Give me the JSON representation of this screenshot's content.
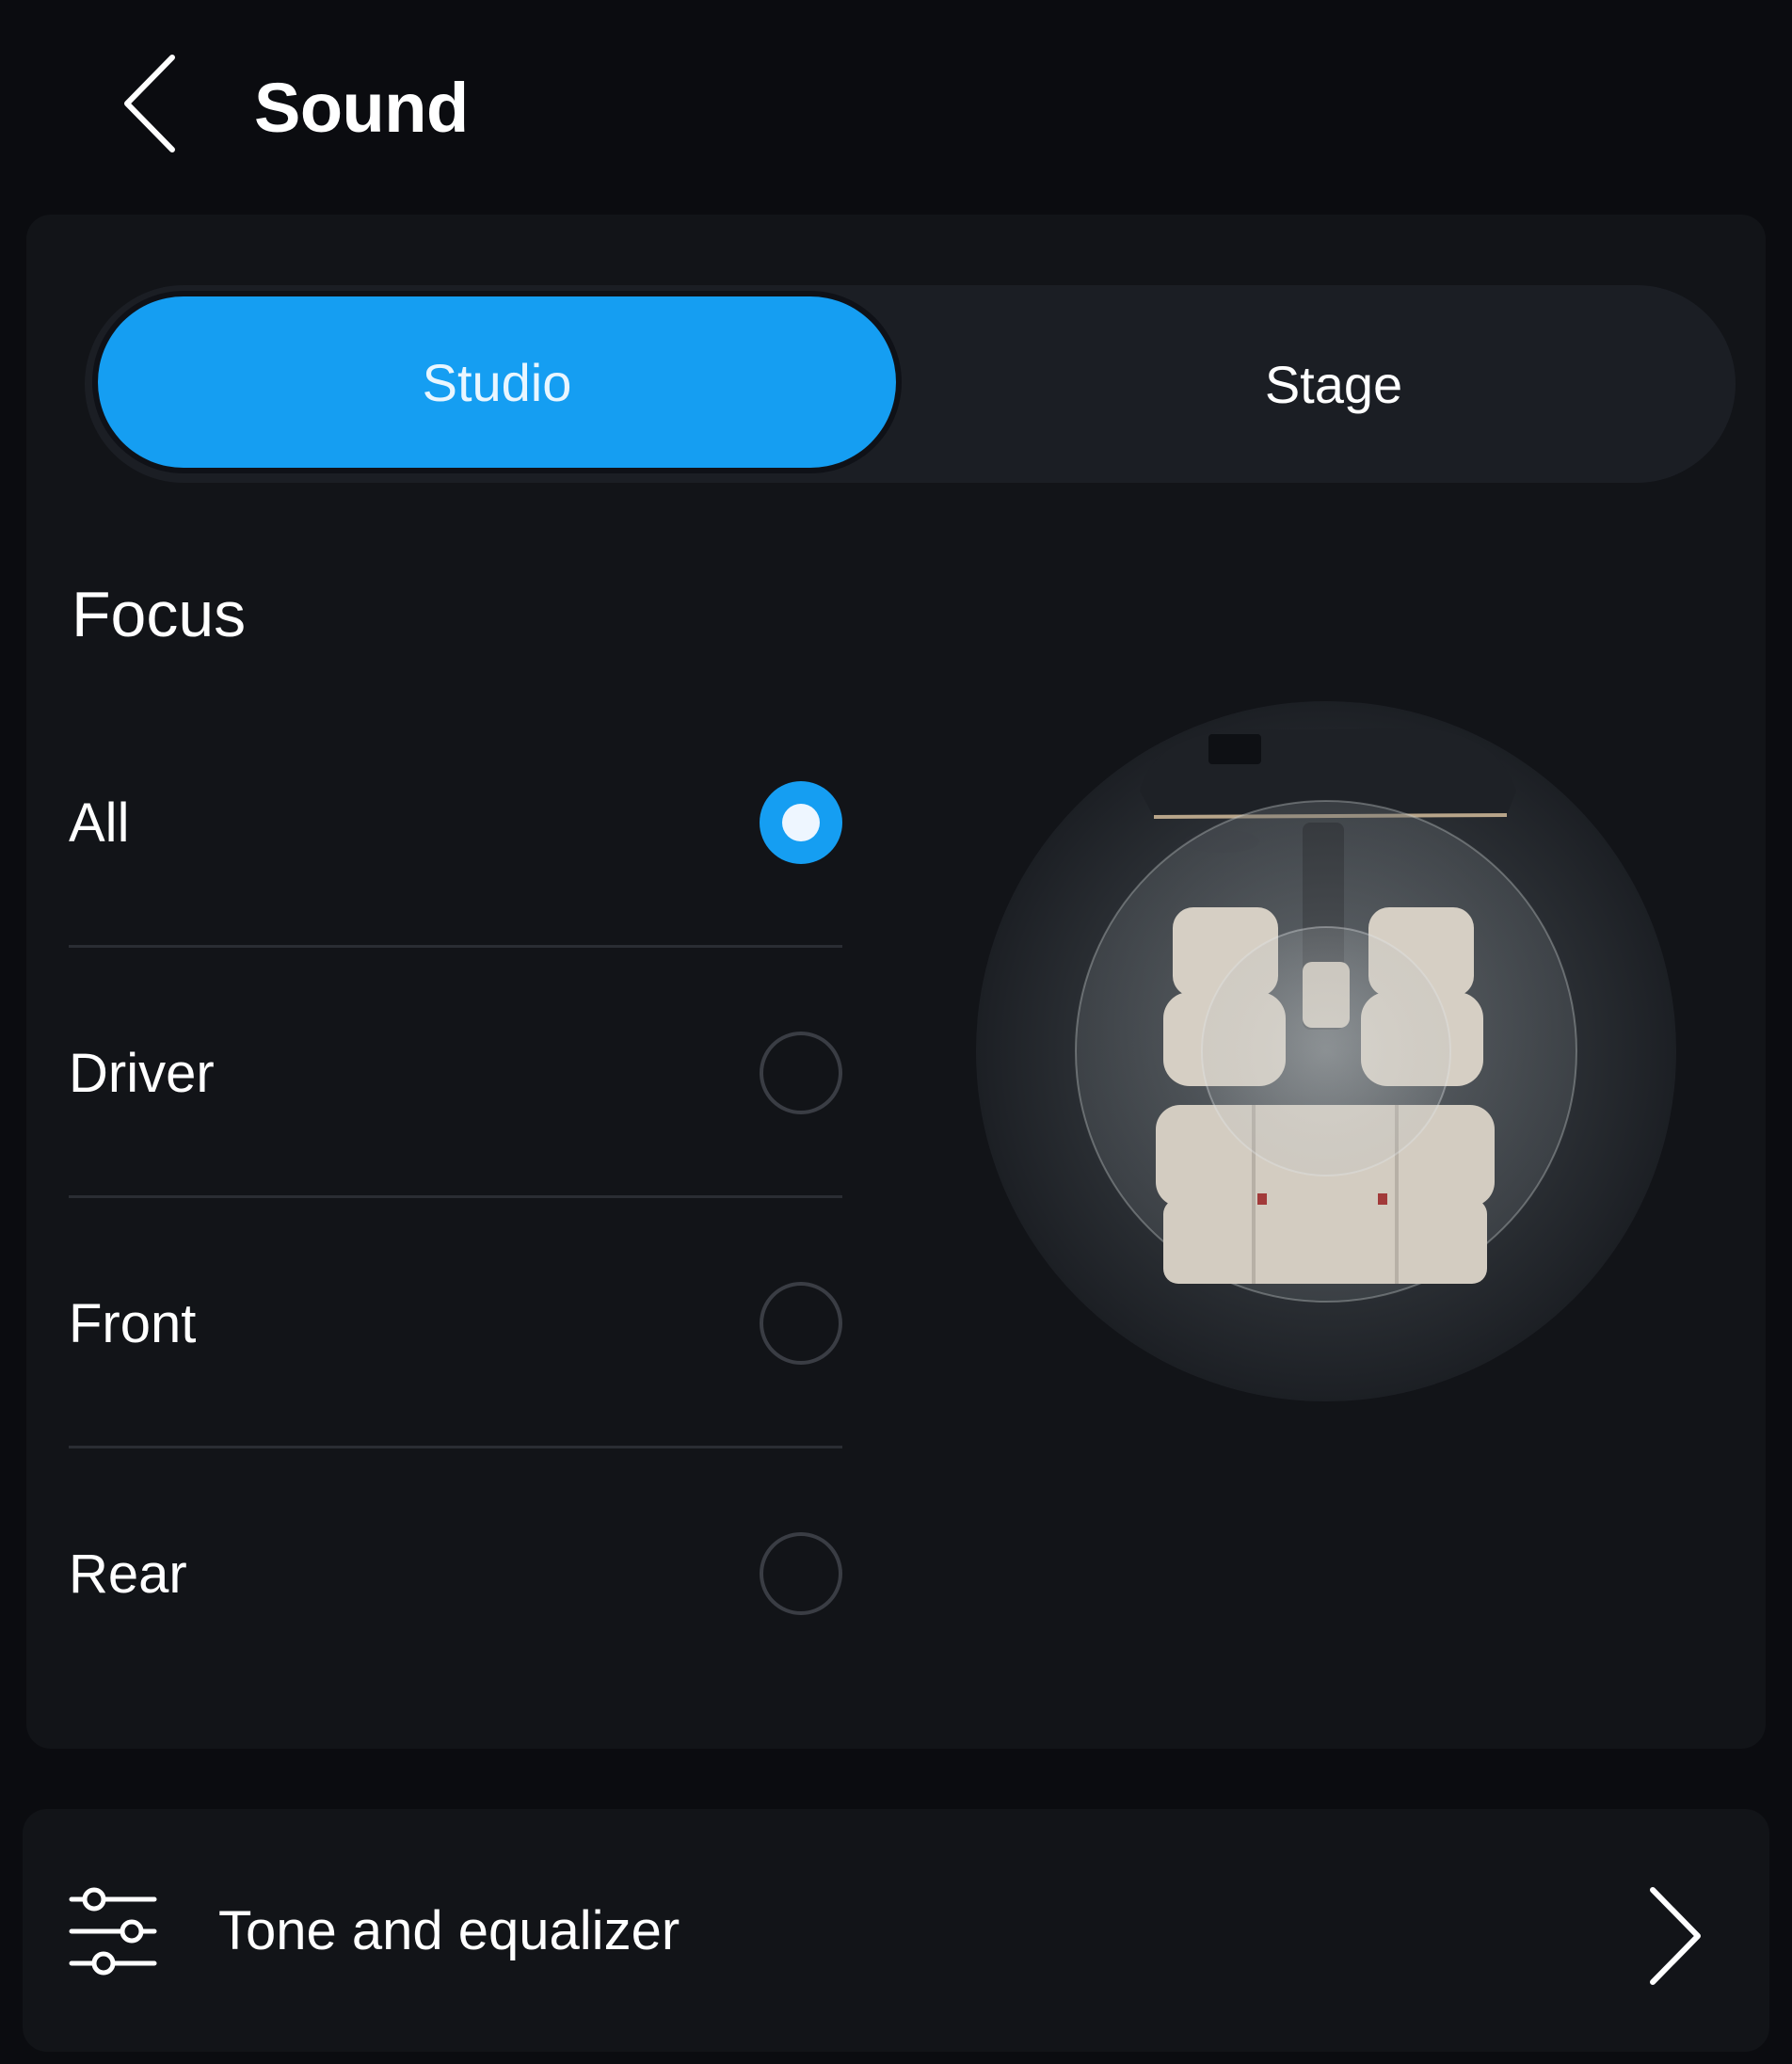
{
  "header": {
    "title": "Sound"
  },
  "mode_selector": {
    "options": [
      {
        "label": "Studio",
        "selected": true
      },
      {
        "label": "Stage",
        "selected": false
      }
    ]
  },
  "focus": {
    "title": "Focus",
    "options": [
      {
        "label": "All",
        "selected": true
      },
      {
        "label": "Driver",
        "selected": false
      },
      {
        "label": "Front",
        "selected": false
      },
      {
        "label": "Rear",
        "selected": false
      }
    ]
  },
  "tone": {
    "label": "Tone and equalizer",
    "icon": "sliders-icon"
  },
  "colors": {
    "accent": "#159ef2",
    "background": "#0b0c10",
    "panel": "#121418"
  }
}
